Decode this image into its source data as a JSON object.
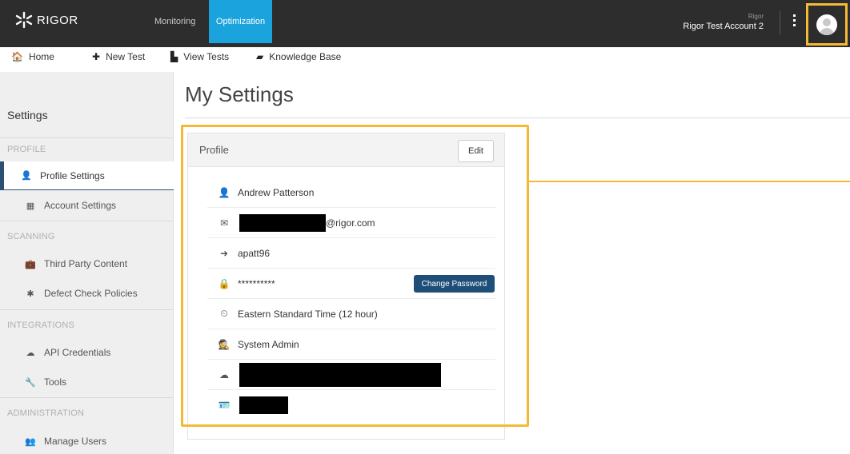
{
  "brand": {
    "name": "RIGOR",
    "logo_icon": "rigor-logo"
  },
  "topnav": {
    "monitoring": "Monitoring",
    "optimization": "Optimization",
    "account_small": "Rigor",
    "account_name": "Rigor Test Account 2",
    "active_color": "#1ba3dd",
    "highlight_color": "#f6b936"
  },
  "subnav": [
    {
      "label": "Home",
      "icon": "home-icon",
      "glyph": "🏠"
    },
    {
      "label": "New Test",
      "icon": "plus-icon",
      "glyph": "✚"
    },
    {
      "label": "View Tests",
      "icon": "bar-chart-icon",
      "glyph": "▙"
    },
    {
      "label": "Knowledge Base",
      "icon": "book-icon",
      "glyph": "▰"
    }
  ],
  "sidebar": {
    "title": "Settings",
    "sections": {
      "profile": "PROFILE",
      "scanning": "SCANNING",
      "integrations": "INTEGRATIONS",
      "administration": "ADMINISTRATION"
    },
    "items": {
      "profile_settings": {
        "label": "Profile Settings",
        "icon": "user-icon",
        "glyph": "👤"
      },
      "account_settings": {
        "label": "Account Settings",
        "icon": "grid-icon",
        "glyph": "▦"
      },
      "third_party": {
        "label": "Third Party Content",
        "icon": "briefcase-icon",
        "glyph": "💼"
      },
      "defect_check": {
        "label": "Defect Check Policies",
        "icon": "bug-icon",
        "glyph": "✱"
      },
      "api_credentials": {
        "label": "API Credentials",
        "icon": "cloud-icon",
        "glyph": "☁"
      },
      "tools": {
        "label": "Tools",
        "icon": "wrench-icon",
        "glyph": "🔧"
      },
      "manage_users": {
        "label": "Manage Users",
        "icon": "users-icon",
        "glyph": "👥"
      }
    }
  },
  "main": {
    "page_title": "My Settings",
    "panel": {
      "title": "Profile",
      "edit_label": "Edit",
      "name": "Andrew Patterson",
      "email_suffix": "@rigor.com",
      "username": "apatt96",
      "password_mask": "**********",
      "change_password_label": "Change Password",
      "timezone": "Eastern Standard Time (12 hour)",
      "role": "System Admin"
    }
  }
}
